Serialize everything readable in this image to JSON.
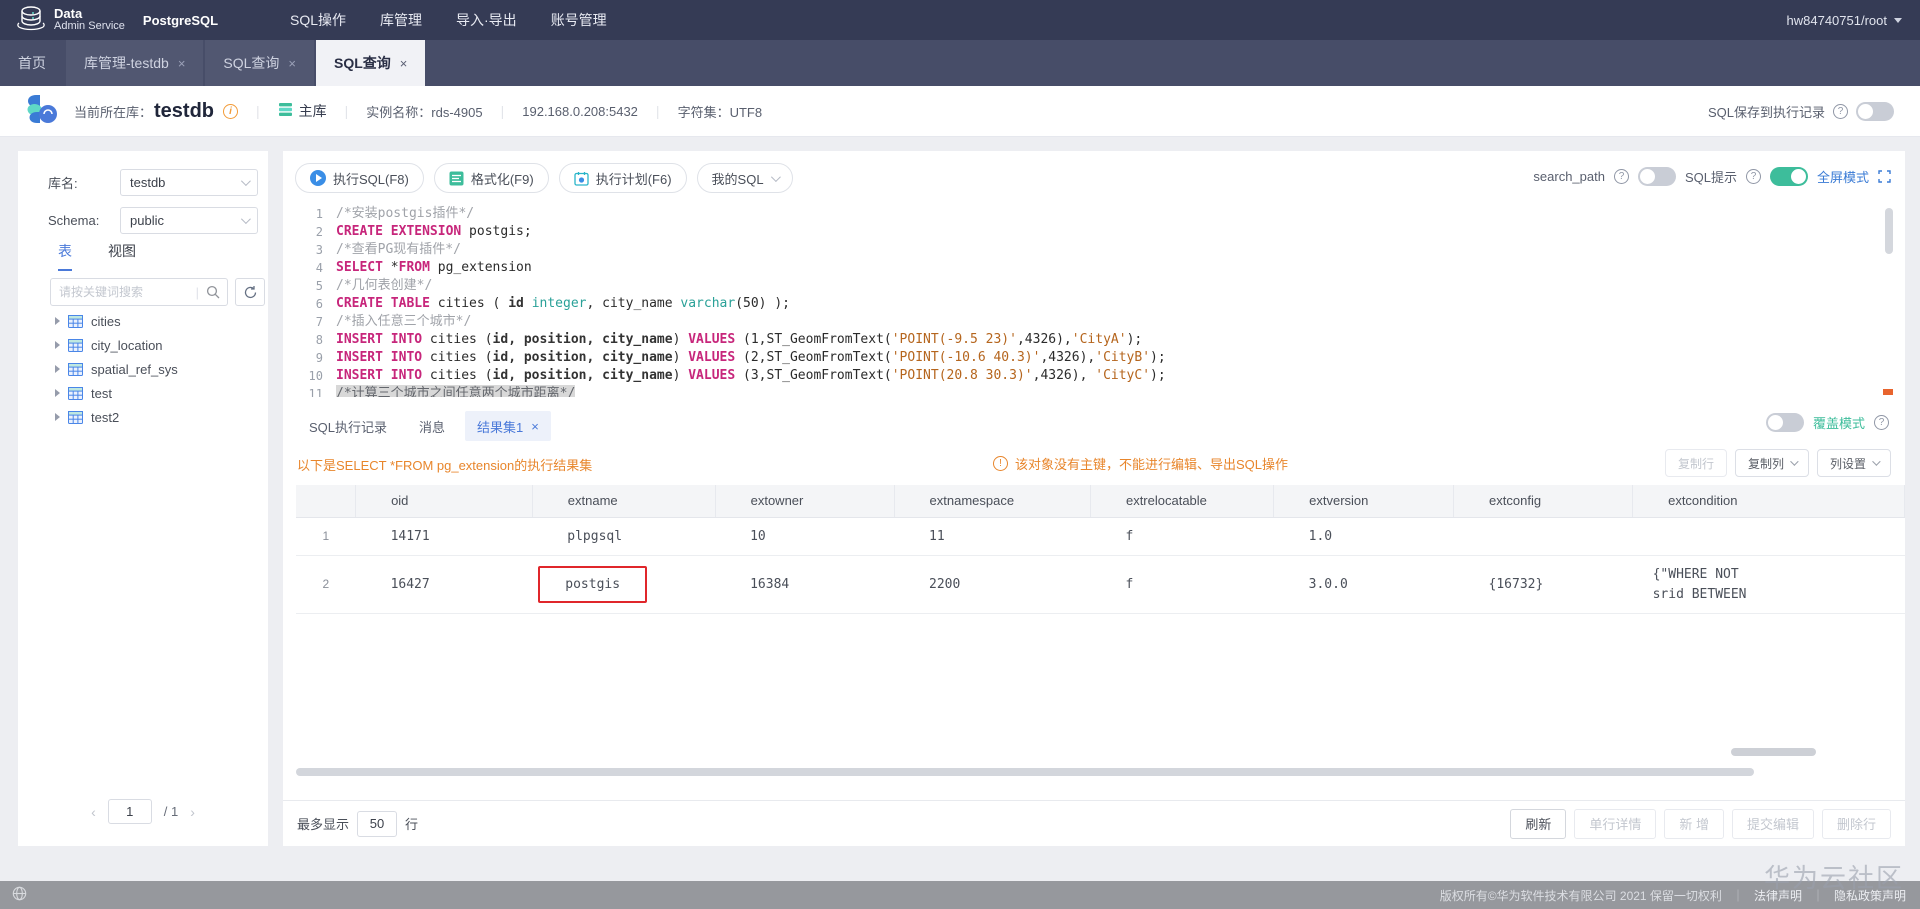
{
  "topnav": {
    "logo_title": "Data",
    "logo_subtitle": "Admin Service",
    "logo_product": "PostgreSQL",
    "menu": [
      "SQL操作",
      "库管理",
      "导入·导出",
      "账号管理"
    ],
    "account": "hw84740751/root"
  },
  "tabs": [
    {
      "label": "首页",
      "closable": false,
      "active": false
    },
    {
      "label": "库管理-testdb",
      "closable": true,
      "active": false
    },
    {
      "label": "SQL查询",
      "closable": true,
      "active": false
    },
    {
      "label": "SQL查询",
      "closable": true,
      "active": true
    }
  ],
  "infobar": {
    "current_db_label": "当前所在库：",
    "current_db": "testdb",
    "primary_label": "主库",
    "instance": "实例名称：rds-4905",
    "address": "192.168.0.208:5432",
    "charset": "字符集：UTF8",
    "save_toggle_label": "SQL保存到执行记录"
  },
  "sidebar": {
    "db_label": "库名:",
    "db_value": "testdb",
    "schema_label": "Schema:",
    "schema_value": "public",
    "tabs": [
      {
        "label": "表",
        "active": true
      },
      {
        "label": "视图",
        "active": false
      }
    ],
    "search_placeholder": "请按关键词搜索",
    "tables": [
      "cities",
      "city_location",
      "spatial_ref_sys",
      "test",
      "test2"
    ],
    "pagination": {
      "page": "1",
      "total": "/ 1"
    }
  },
  "editor_toolbar": {
    "run": "执行SQL(F8)",
    "format": "格式化(F9)",
    "plan": "执行计划(F6)",
    "my_sql": "我的SQL",
    "search_path": "search_path",
    "sql_hint": "SQL提示",
    "fullscreen": "全屏模式"
  },
  "editor": {
    "lines": [
      {
        "n": "1",
        "seg": [
          [
            "c",
            "/*安装postgis插件*/"
          ]
        ]
      },
      {
        "n": "2",
        "seg": [
          [
            "k",
            "CREATE EXTENSION"
          ],
          [
            "p",
            " postgis;"
          ]
        ]
      },
      {
        "n": "3",
        "seg": [
          [
            "c",
            "/*查看PG现有插件*/"
          ]
        ]
      },
      {
        "n": "4",
        "seg": [
          [
            "k",
            "SELECT"
          ],
          [
            "p",
            " *"
          ],
          [
            "k",
            "FROM"
          ],
          [
            "p",
            " pg_extension"
          ]
        ]
      },
      {
        "n": "5",
        "seg": [
          [
            "c",
            "/*几何表创建*/"
          ]
        ]
      },
      {
        "n": "6",
        "seg": [
          [
            "k",
            "CREATE TABLE"
          ],
          [
            "p",
            " cities ( "
          ],
          [
            "i",
            "id"
          ],
          [
            "p",
            " "
          ],
          [
            "t",
            "integer"
          ],
          [
            "p",
            ", city_name "
          ],
          [
            "t",
            "varchar"
          ],
          [
            "p",
            "(50) );"
          ]
        ]
      },
      {
        "n": "7",
        "seg": [
          [
            "c",
            "/*插入任意三个城市*/"
          ]
        ]
      },
      {
        "n": "8",
        "seg": [
          [
            "k",
            "INSERT INTO"
          ],
          [
            "p",
            " cities ("
          ],
          [
            "i",
            "id, position, city_name"
          ],
          [
            "p",
            ") "
          ],
          [
            "k",
            "VALUES"
          ],
          [
            "p",
            " (1,ST_GeomFromText("
          ],
          [
            "s",
            "'POINT(-9.5 23)'"
          ],
          [
            "p",
            ",4326),"
          ],
          [
            "s",
            "'CityA'"
          ],
          [
            "p",
            ");"
          ]
        ]
      },
      {
        "n": "9",
        "seg": [
          [
            "k",
            "INSERT INTO"
          ],
          [
            "p",
            " cities ("
          ],
          [
            "i",
            "id, position, city_name"
          ],
          [
            "p",
            ") "
          ],
          [
            "k",
            "VALUES"
          ],
          [
            "p",
            " (2,ST_GeomFromText("
          ],
          [
            "s",
            "'POINT(-10.6 40.3)'"
          ],
          [
            "p",
            ",4326),"
          ],
          [
            "s",
            "'CityB'"
          ],
          [
            "p",
            ");"
          ]
        ]
      },
      {
        "n": "10",
        "seg": [
          [
            "k",
            "INSERT INTO"
          ],
          [
            "p",
            " cities ("
          ],
          [
            "i",
            "id, position, city_name"
          ],
          [
            "p",
            ") "
          ],
          [
            "k",
            "VALUES"
          ],
          [
            "p",
            " (3,ST_GeomFromText("
          ],
          [
            "s",
            "'POINT(20.8 30.3)'"
          ],
          [
            "p",
            ",4326), "
          ],
          [
            "s",
            "'CityC'"
          ],
          [
            "p",
            ");"
          ]
        ]
      },
      {
        "n": "11",
        "seg": [
          [
            "sel",
            "/*计算三个城市之间任意两个城市距离*/"
          ]
        ]
      }
    ]
  },
  "result": {
    "tabs": [
      "SQL执行记录",
      "消息",
      "结果集1"
    ],
    "overwrite_label": "覆盖模式",
    "summary": "以下是SELECT *FROM pg_extension的执行结果集",
    "warning": "该对象没有主键，不能进行编辑、导出SQL操作",
    "actions": [
      {
        "label": "复制行",
        "enabled": false,
        "dropdown": false
      },
      {
        "label": "复制列",
        "enabled": true,
        "dropdown": true
      },
      {
        "label": "列设置",
        "enabled": true,
        "dropdown": true
      }
    ],
    "columns": [
      "oid",
      "extname",
      "extowner",
      "extnamespace",
      "extrelocatable",
      "extversion",
      "extconfig",
      "extcondition"
    ],
    "rows": [
      {
        "num": "1",
        "cells": [
          "14171",
          "plpgsql",
          "10",
          "11",
          "f",
          "1.0",
          "",
          ""
        ]
      },
      {
        "num": "2",
        "cells": [
          "16427",
          "postgis",
          "16384",
          "2200",
          "f",
          "3.0.0",
          "{16732}",
          "{\"WHERE NOT\nsrid BETWEEN"
        ],
        "highlight_col": 1
      }
    ],
    "footer": {
      "max_label": "最多显示",
      "max_value": "50",
      "rows_label": "行",
      "buttons": [
        {
          "label": "刷新",
          "enabled": true
        },
        {
          "label": "单行详情",
          "enabled": false
        },
        {
          "label": "新 增",
          "enabled": false
        },
        {
          "label": "提交编辑",
          "enabled": false
        },
        {
          "label": "删除行",
          "enabled": false
        }
      ]
    }
  },
  "footer": {
    "copyright": "版权所有©华为软件技术有限公司 2021 保留一切权利",
    "legal": "法律声明",
    "privacy": "隐私政策声明",
    "watermark": "华为云社区"
  },
  "colors": {
    "accent_blue": "#3a7bd5",
    "toggle_on": "#3dbd9b",
    "warning_orange": "#e8862c",
    "highlight_red": "#e0262b",
    "keyword_magenta": "#c7267b"
  }
}
